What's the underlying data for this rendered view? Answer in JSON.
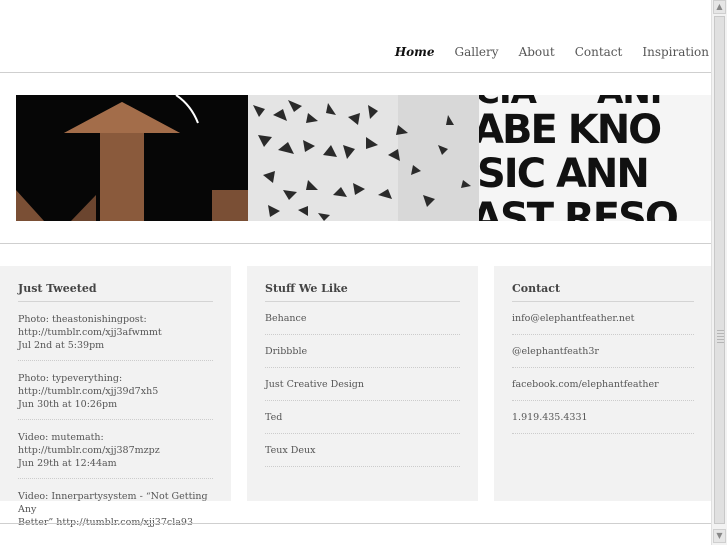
{
  "nav": {
    "items": [
      "Home",
      "Gallery",
      "About",
      "Contact",
      "Inspiration"
    ],
    "active": "Home"
  },
  "tweets": {
    "heading": "Just Tweeted",
    "items": [
      {
        "line1": "Photo: theastonishingpost:",
        "line2": "http://tumblr.com/xjj3afwmmt",
        "time": "Jul 2nd at 5:39pm"
      },
      {
        "line1": "Photo: typeverything:",
        "line2": "http://tumblr.com/xjj39d7xh5",
        "time": "Jun 30th at 10:26pm"
      },
      {
        "line1": "Video: mutemath:",
        "line2": "http://tumblr.com/xjj387mzpz",
        "time": "Jun 29th at 12:44am"
      },
      {
        "line1": "Video: Innerpartysystem - “Not Getting Any",
        "line2": "Better” http://tumblr.com/xjj37cla93",
        "time": ""
      }
    ]
  },
  "stuff": {
    "heading": "Stuff We Like",
    "items": [
      "Behance",
      "Dribbble",
      "Just Creative Design",
      "Ted",
      "Teux Deux"
    ]
  },
  "contact": {
    "heading": "Contact",
    "items": [
      "info@elephantfeather.net",
      "@elephantfeath3r",
      "facebook.com/elephantfeather",
      "1.919.435.4331"
    ]
  },
  "banner": {
    "panel3_words": [
      "ABE KNO",
      "SIC ANN",
      "AST RESO"
    ]
  }
}
